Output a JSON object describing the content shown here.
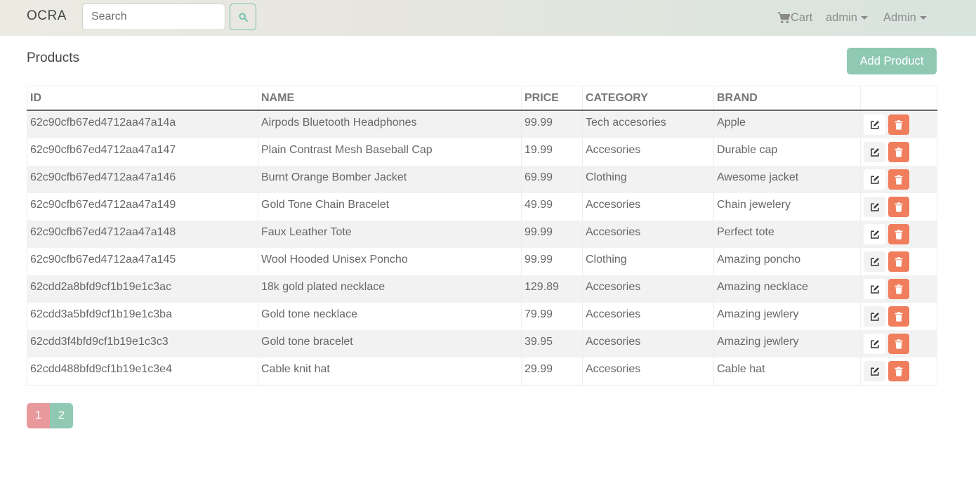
{
  "navbar": {
    "brand": "OCRA",
    "search_placeholder": "Search",
    "cart_label": "Cart",
    "user_label": "admin",
    "admin_label": "Admin"
  },
  "page": {
    "title": "Products",
    "add_button_label": "Add Product"
  },
  "table": {
    "headers": [
      "ID",
      "NAME",
      "PRICE",
      "CATEGORY",
      "BRAND",
      ""
    ],
    "rows": [
      {
        "id": "62c90cfb67ed4712aa47a14a",
        "name": "Airpods Bluetooth Headphones",
        "price": "99.99",
        "category": "Tech accesories",
        "brand": "Apple"
      },
      {
        "id": "62c90cfb67ed4712aa47a147",
        "name": "Plain Contrast Mesh Baseball Cap",
        "price": "19.99",
        "category": "Accesories",
        "brand": "Durable cap"
      },
      {
        "id": "62c90cfb67ed4712aa47a146",
        "name": "Burnt Orange Bomber Jacket",
        "price": "69.99",
        "category": "Clothing",
        "brand": "Awesome jacket"
      },
      {
        "id": "62c90cfb67ed4712aa47a149",
        "name": "Gold Tone Chain Bracelet",
        "price": "49.99",
        "category": "Accesories",
        "brand": "Chain jewelery"
      },
      {
        "id": "62c90cfb67ed4712aa47a148",
        "name": "Faux Leather Tote",
        "price": "99.99",
        "category": "Accesories",
        "brand": "Perfect tote"
      },
      {
        "id": "62c90cfb67ed4712aa47a145",
        "name": "Wool Hooded Unisex Poncho",
        "price": "99.99",
        "category": "Clothing",
        "brand": "Amazing poncho"
      },
      {
        "id": "62cdd2a8bfd9cf1b19e1c3ac",
        "name": "18k gold plated necklace",
        "price": "129.89",
        "category": "Accesories",
        "brand": "Amazing necklace"
      },
      {
        "id": "62cdd3a5bfd9cf1b19e1c3ba",
        "name": "Gold tone necklace",
        "price": "79.99",
        "category": "Accesories",
        "brand": "Amazing jewlery"
      },
      {
        "id": "62cdd3f4bfd9cf1b19e1c3c3",
        "name": "Gold tone bracelet",
        "price": "39.95",
        "category": "Accesories",
        "brand": "Amazing jewlery"
      },
      {
        "id": "62cdd488bfd9cf1b19e1c3e4",
        "name": "Cable knit hat",
        "price": "29.99",
        "category": "Accesories",
        "brand": "Cable hat"
      }
    ]
  },
  "pagination": {
    "pages": [
      "1",
      "2"
    ],
    "active": "1"
  },
  "icons": {
    "search": "search-icon",
    "cart": "cart-icon",
    "edit": "edit-icon",
    "delete": "trash-icon"
  },
  "colors": {
    "accent": "#78c2ad",
    "danger": "#f07d5c",
    "active_page": "#e8999b"
  }
}
